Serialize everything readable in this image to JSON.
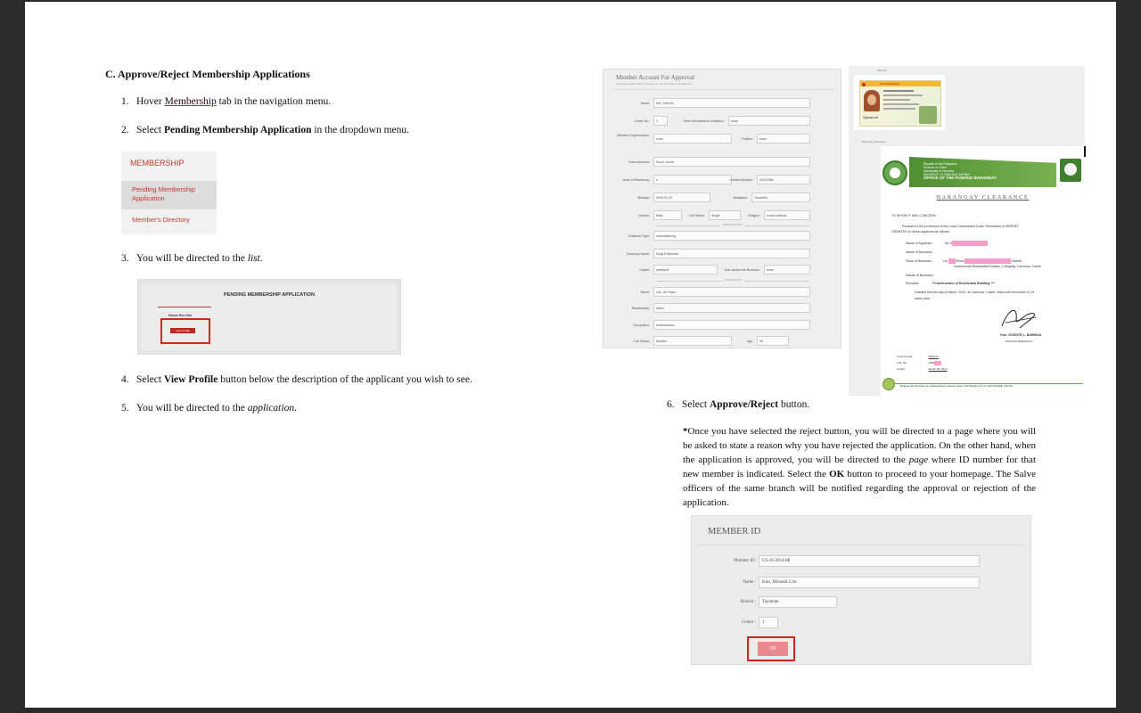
{
  "section_title": "C. Approve/Reject Membership Applications",
  "steps": {
    "s1": {
      "num": "1.",
      "pre": "Hover ",
      "link": "Membership",
      "post": " tab in the navigation menu."
    },
    "s2": {
      "num": "2.",
      "pre": "Select ",
      "bold": "Pending Membership Application",
      "post": " in the dropdown menu."
    },
    "s3": {
      "num": "3.",
      "pre": "You will be directed to the ",
      "italic": "list",
      "post": "."
    },
    "s4": {
      "num": "4.",
      "pre": "Select ",
      "bold": "View Profile",
      "post": " button below the description of the applicant you wish to see."
    },
    "s5": {
      "num": "5.",
      "pre": "You will be directed to the ",
      "italic": "application",
      "post": "."
    },
    "s6": {
      "num": "6.",
      "pre": "Select ",
      "bold": "Approve/Reject",
      "post": " button."
    }
  },
  "membership_menu": {
    "header": "MEMBERSHIP",
    "item1": "Pending Membership Application",
    "item2": "Member's Directory"
  },
  "pending_list": {
    "title": "PENDING MEMBERSHIP APPLICATION",
    "applicant_name": "Kibum Kim Kim",
    "view_profile": "View Profile"
  },
  "member_form": {
    "title": "Member Account For Approval",
    "subtitle": "Contact the Salve Officer in charge for any information discrepancies",
    "name_label": "Name:",
    "name": "Kim, Hee Bo",
    "center_label": "Center No.:",
    "center": "1",
    "micro_label": "Other Microfinance Institution:",
    "micro": "none",
    "org_label": "Affiliated Organizations:",
    "org": "none",
    "position_label": "Position:",
    "position": "none",
    "address_label": "Home Address:",
    "address": "Seoul, Korea",
    "residency_label": "Years of Residency:",
    "residency": "n",
    "contact_label": "Contact Number:",
    "contact": "09123456",
    "birthday_label": "Birthday:",
    "birthday": "0000-00-00",
    "birthplace_label": "Birthplace:",
    "birthplace": "Tarnavilla",
    "gender_label": "Gender:",
    "gender": "Male",
    "civil_label": "Civil Status:",
    "civil": "Single",
    "religion_label": "Religion:",
    "religion": "roman catholic",
    "div1": "BACKGROUND",
    "btype_label": "Business Type:",
    "btype": "manufacturing",
    "company_label": "Company Name:",
    "company": "Kong Enterprise",
    "capital_label": "Capital:",
    "capital": "qwdfrjkdf",
    "yrs_label": "Year started the Business:",
    "yrs": "none",
    "div2": "HOUSEHOLD",
    "hname_label": "Name:",
    "hname": "Lee, Jin Hwan",
    "rel_label": "Relationship:",
    "rel": "father",
    "occ_label": "Occupation:",
    "occ": "businessman",
    "hcivil_label": "Civil Status:",
    "hcivil": "Married",
    "age_label": "Age:",
    "age": "25"
  },
  "valid_id": {
    "label": "Valid ID:",
    "card_header": "NON-RESIDENT",
    "sign": "Signature"
  },
  "clearance": {
    "label": "Barangay Clearance:",
    "header1": "Republic of the Philippines",
    "header2": "Province of Cavite",
    "header3": "Municipality of Carmona",
    "header4": "BARANGAY 10 CABILANG BAYBAY",
    "header5": "OFFICE OF THE PUNONG BARANGAY",
    "title": "BARANGAY CLEARANCE",
    "salutation": "TO WHOM IT MAY CONCERN:",
    "body1": "Pursuant to the provisions of the Local Government Code, Permission is HEREBY",
    "body2": "GRANTED to herein applicant as follows:",
    "applicant_label": "Name of Applicant",
    "applicant": "Mr. A",
    "business_label": "Name of Business",
    "business": ":",
    "place_label": "Place of Business",
    "place_pre": "Lot",
    "place_mid": "Block",
    "place_post": "Manila",
    "place2": "Southwoods Residential Estates, C.Baybay, Carmona, Cavite",
    "nature_label": "Nature of Business",
    "nature": ":",
    "remarks_label": "Remarks",
    "remarks": "**Construction of Residential Building ***",
    "granted1": "Granted this 6th day of March, 2012, at Carmona, Cavite. Valid until December 31 of",
    "granted2": "same year.",
    "signer": "Hon. VICENTE L. BARRIAS",
    "signer_title": "PUNONG BARANGAY",
    "amount_label": "Amount Paid",
    "amount": "P500.00",
    "or_label": "O.R. No.",
    "or": "0069",
    "issued_label": "Issued",
    "issued": "March 06, 2012",
    "footer": "Barangay Hall, San Roque St. Cabilang Baybay, Carmona, Cavite, 4116 Philippines Tel. No. (046) 430-0838 • 430-0117"
  },
  "paragraph": {
    "star": "*",
    "t1": "Once you have selected the reject button, you will be directed to a page where you will be asked to state a reason why you have rejected the application. On the other hand, when the application is approved, you will be directed to the ",
    "italic": "page",
    "t2": " where ID number for that new member is indicated. Select the ",
    "bold": "OK",
    "t3": " button to proceed to your homepage. The Salve officers of the same branch will be notified regarding the approval or rejection of the application."
  },
  "member_id": {
    "title": "MEMBER ID",
    "id_label": "Member ID:",
    "id": "CS-10-2014-88",
    "name_label": "Name :",
    "name": "Kim, Minseok Lim",
    "branch_label": "Branch :",
    "branch": "Tayuman",
    "center_label": "Center :",
    "center": "1",
    "ok": "OK"
  },
  "colors": {
    "red": "#d9241b",
    "menu_red": "#c0392b",
    "ok_pink": "#e8898f"
  }
}
